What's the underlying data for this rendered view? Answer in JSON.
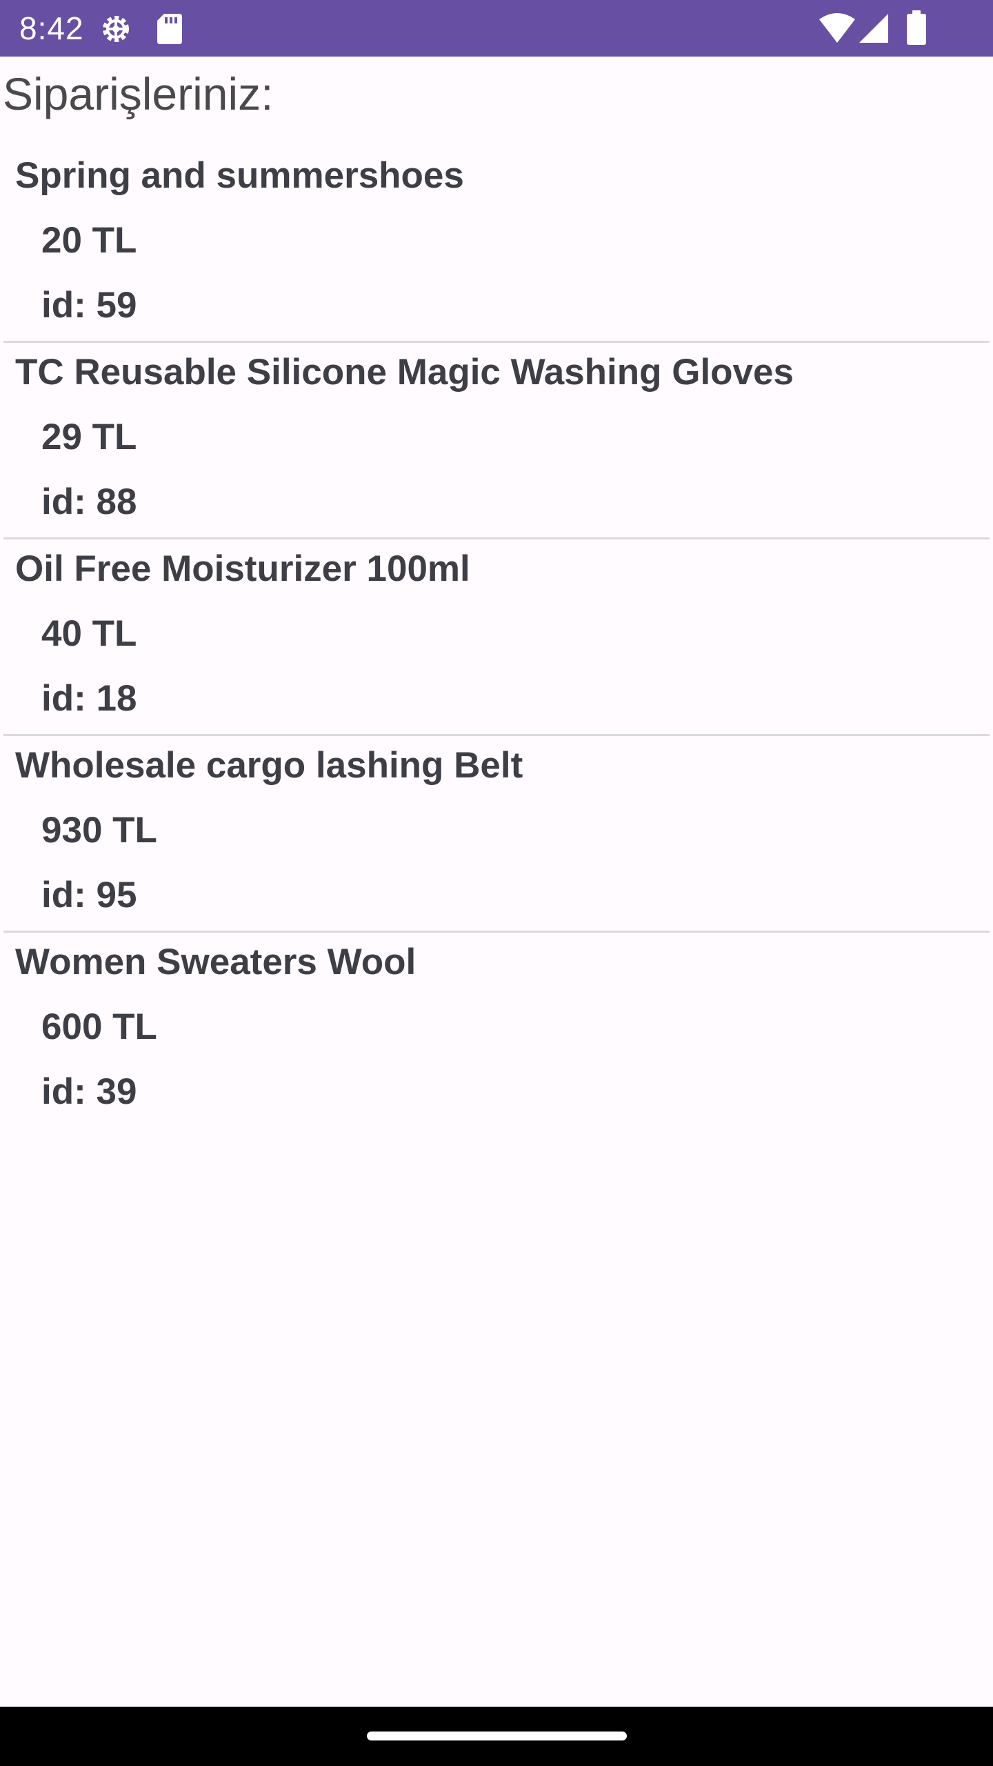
{
  "status_bar": {
    "time": "8:42",
    "icons": [
      "settings-gear-icon",
      "sd-card-icon",
      "wifi-icon",
      "cellular-signal-icon",
      "battery-icon"
    ],
    "background_color": "#6750a4"
  },
  "page": {
    "title": "Siparişleriniz:"
  },
  "orders": [
    {
      "name": "Spring and summershoes",
      "price": "20 TL",
      "id": "id: 59"
    },
    {
      "name": "TC Reusable Silicone Magic Washing Gloves",
      "price": "29 TL",
      "id": "id: 88"
    },
    {
      "name": "Oil Free Moisturizer 100ml",
      "price": "40 TL",
      "id": "id: 18"
    },
    {
      "name": "Wholesale cargo lashing Belt",
      "price": "930 TL",
      "id": "id: 95"
    },
    {
      "name": "Women Sweaters Wool",
      "price": "600 TL",
      "id": "id: 39"
    }
  ]
}
